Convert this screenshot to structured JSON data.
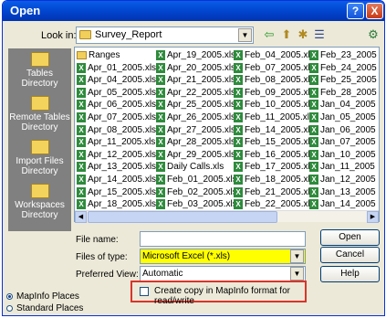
{
  "dialog": {
    "title": "Open",
    "help_label": "?",
    "close_label": "X"
  },
  "lookin": {
    "label": "Look in:",
    "value": "Survey_Report"
  },
  "places": [
    {
      "label": "Tables Directory"
    },
    {
      "label": "Remote Tables Directory"
    },
    {
      "label": "Import Files Directory"
    },
    {
      "label": "Workspaces Directory"
    }
  ],
  "files": {
    "col1": [
      "Ranges",
      "Apr_01_2005.xls",
      "Apr_04_2005.xls",
      "Apr_05_2005.xls",
      "Apr_06_2005.xls",
      "Apr_07_2005.xls",
      "Apr_08_2005.xls",
      "Apr_11_2005.xls",
      "Apr_12_2005.xls",
      "Apr_13_2005.xls",
      "Apr_14_2005.xls",
      "Apr_15_2005.xls",
      "Apr_18_2005.xls"
    ],
    "col2": [
      "Apr_19_2005.xls",
      "Apr_20_2005.xls",
      "Apr_21_2005.xls",
      "Apr_22_2005.xls",
      "Apr_25_2005.xls",
      "Apr_26_2005.xls",
      "Apr_27_2005.xls",
      "Apr_28_2005.xls",
      "Apr_29_2005.xls",
      "Daily Calls.xls",
      "Feb_01_2005.xls",
      "Feb_02_2005.xls",
      "Feb_03_2005.xls"
    ],
    "col3": [
      "Feb_04_2005.xls",
      "Feb_07_2005.xls",
      "Feb_08_2005.xls",
      "Feb_09_2005.xls",
      "Feb_10_2005.xls",
      "Feb_11_2005.xls",
      "Feb_14_2005.xls",
      "Feb_15_2005.xls",
      "Feb_16_2005.xls",
      "Feb_17_2005.xls",
      "Feb_18_2005.xls",
      "Feb_21_2005.xls",
      "Feb_22_2005.xls"
    ],
    "col4": [
      "Feb_23_2005",
      "Feb_24_2005",
      "Feb_25_2005",
      "Feb_28_2005",
      "Jan_04_2005",
      "Jan_05_2005",
      "Jan_06_2005",
      "Jan_07_2005",
      "Jan_10_2005",
      "Jan_11_2005",
      "Jan_12_2005",
      "Jan_13_2005",
      "Jan_14_2005"
    ]
  },
  "form": {
    "filename_label": "File name:",
    "filename_value": "",
    "filetype_label": "Files of type:",
    "filetype_value": "Microsoft Excel (*.xls)",
    "view_label": "Preferred View:",
    "view_value": "Automatic"
  },
  "buttons": {
    "open": "Open",
    "cancel": "Cancel",
    "help": "Help"
  },
  "copy_option": {
    "label": "Create copy in MapInfo format for read/write",
    "checked": false
  },
  "radios": [
    {
      "label": "MapInfo Places",
      "selected": true
    },
    {
      "label": "Standard Places",
      "selected": false
    }
  ],
  "colors": {
    "titlebar": "#0148d2",
    "highlight_field": "#ffff00",
    "callout_border": "#d9352a",
    "places_bg": "#808080"
  }
}
